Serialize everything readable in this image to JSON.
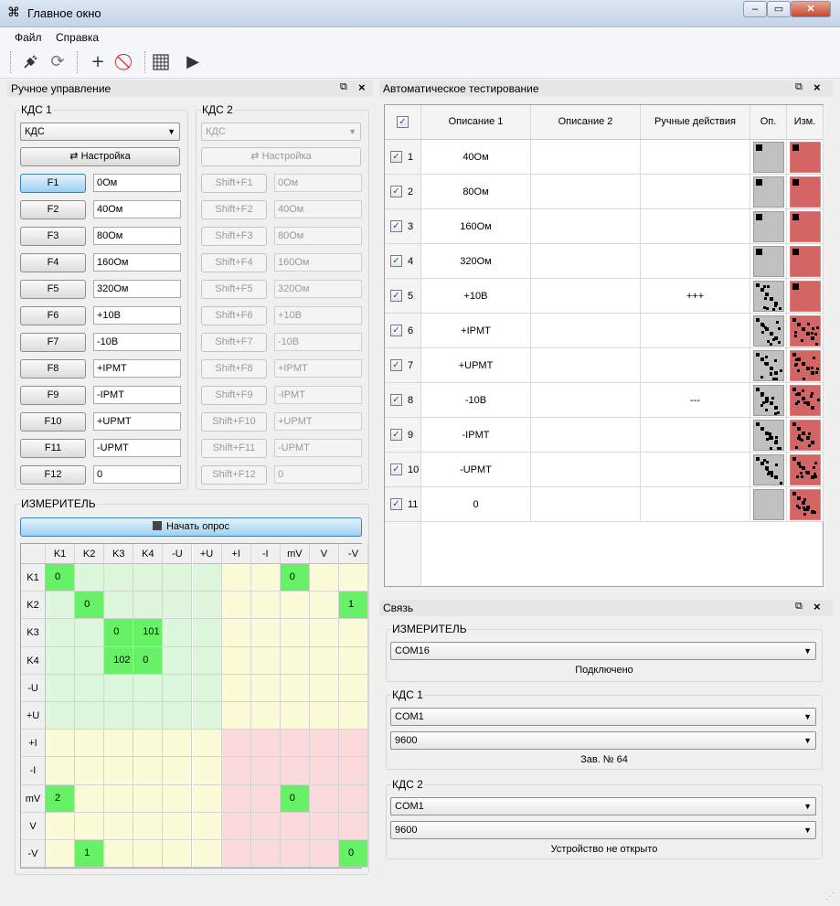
{
  "window": {
    "title": "Главное окно",
    "icon": "app-icon"
  },
  "menu": [
    "Файл",
    "Справка"
  ],
  "toolbar": {
    "icons": [
      "plug-icon",
      "refresh-icon",
      "add-icon",
      "stop-icon",
      "grid-icon",
      "play-icon"
    ]
  },
  "manual": {
    "title": "Ручное управление",
    "kds1": {
      "label": "КДС 1",
      "select": "КДС",
      "settings": "Настройка",
      "rows": [
        {
          "key": "F1",
          "value": "0Ом"
        },
        {
          "key": "F2",
          "value": "40Ом"
        },
        {
          "key": "F3",
          "value": "80Ом"
        },
        {
          "key": "F4",
          "value": "160Ом"
        },
        {
          "key": "F5",
          "value": "320Ом"
        },
        {
          "key": "F6",
          "value": "+10В"
        },
        {
          "key": "F7",
          "value": "-10В"
        },
        {
          "key": "F8",
          "value": "+IPMT"
        },
        {
          "key": "F9",
          "value": "-IPMT"
        },
        {
          "key": "F10",
          "value": "+UPMT"
        },
        {
          "key": "F11",
          "value": "-UPMT"
        },
        {
          "key": "F12",
          "value": "0"
        }
      ]
    },
    "kds2": {
      "label": "КДС 2",
      "select": "КДС",
      "settings": "Настройка",
      "rows": [
        {
          "key": "Shift+F1",
          "value": "0Ом"
        },
        {
          "key": "Shift+F2",
          "value": "40Ом"
        },
        {
          "key": "Shift+F3",
          "value": "80Ом"
        },
        {
          "key": "Shift+F4",
          "value": "160Ом"
        },
        {
          "key": "Shift+F5",
          "value": "320Ом"
        },
        {
          "key": "Shift+F6",
          "value": "+10В"
        },
        {
          "key": "Shift+F7",
          "value": "-10В"
        },
        {
          "key": "Shift+F8",
          "value": "+IPMT"
        },
        {
          "key": "Shift+F9",
          "value": "-IPMT"
        },
        {
          "key": "Shift+F10",
          "value": "+UPMT"
        },
        {
          "key": "Shift+F11",
          "value": "-UPMT"
        },
        {
          "key": "Shift+F12",
          "value": "0"
        }
      ]
    }
  },
  "meter": {
    "label": "ИЗМЕРИТЕЛЬ",
    "start": "Начать опрос",
    "columns": [
      "K1",
      "K2",
      "K3",
      "K4",
      "-U",
      "+U",
      "+I",
      "-I",
      "mV",
      "V",
      "-V"
    ],
    "rows": [
      "K1",
      "K2",
      "K3",
      "K4",
      "-U",
      "+U",
      "+I",
      "-I",
      "mV",
      "V",
      "-V"
    ],
    "cells": [
      [
        "0",
        "",
        "",
        "",
        "",
        "",
        "",
        "",
        "0",
        "",
        ""
      ],
      [
        "",
        "0",
        "",
        "",
        "",
        "",
        "",
        "",
        "",
        "",
        "1"
      ],
      [
        "",
        "",
        "0",
        "101",
        "",
        "",
        "",
        "",
        "",
        "",
        ""
      ],
      [
        "",
        "",
        "102",
        "0",
        "",
        "",
        "",
        "",
        "",
        "",
        ""
      ],
      [
        "",
        "",
        "",
        "",
        "",
        "",
        "",
        "",
        "",
        "",
        ""
      ],
      [
        "",
        "",
        "",
        "",
        "",
        "",
        "",
        "",
        "",
        "",
        ""
      ],
      [
        "",
        "",
        "",
        "",
        "",
        "",
        "",
        "",
        "",
        "",
        ""
      ],
      [
        "",
        "",
        "",
        "",
        "",
        "",
        "",
        "",
        "",
        "",
        ""
      ],
      [
        "2",
        "",
        "",
        "",
        "",
        "",
        "",
        "",
        "0",
        "",
        ""
      ],
      [
        "",
        "",
        "",
        "",
        "",
        "",
        "",
        "",
        "",
        "",
        ""
      ],
      [
        "",
        "1",
        "",
        "",
        "",
        "",
        "",
        "",
        "",
        "",
        "0"
      ]
    ],
    "colors": {
      "green": "#ddf7dd",
      "yellow": "#fbfbd8",
      "red": "#fadadb",
      "value": "#67f167"
    }
  },
  "auto": {
    "title": "Автоматическое тестирование",
    "headers": [
      "Описание 1",
      "Описание 2",
      "Ручные действия",
      "Оп.",
      "Изм."
    ],
    "rows": [
      {
        "n": "1",
        "d1": "40Ом",
        "d2": "",
        "manual": "",
        "op": "single",
        "izm": "single"
      },
      {
        "n": "2",
        "d1": "80Ом",
        "d2": "",
        "manual": "",
        "op": "single",
        "izm": "single"
      },
      {
        "n": "3",
        "d1": "160Ом",
        "d2": "",
        "manual": "",
        "op": "single",
        "izm": "single"
      },
      {
        "n": "4",
        "d1": "320Ом",
        "d2": "",
        "manual": "",
        "op": "single",
        "izm": "single"
      },
      {
        "n": "5",
        "d1": "+10В",
        "d2": "",
        "manual": "+++",
        "op": "pattern",
        "izm": "single"
      },
      {
        "n": "6",
        "d1": "+IPMT",
        "d2": "",
        "manual": "",
        "op": "pattern",
        "izm": "pattern"
      },
      {
        "n": "7",
        "d1": "+UPMT",
        "d2": "",
        "manual": "",
        "op": "pattern",
        "izm": "pattern"
      },
      {
        "n": "8",
        "d1": "-10В",
        "d2": "",
        "manual": "---",
        "op": "pattern",
        "izm": "pattern"
      },
      {
        "n": "9",
        "d1": "-IPMT",
        "d2": "",
        "manual": "",
        "op": "pattern",
        "izm": "pattern"
      },
      {
        "n": "10",
        "d1": "-UPMT",
        "d2": "",
        "manual": "",
        "op": "pattern",
        "izm": "pattern"
      },
      {
        "n": "11",
        "d1": "0",
        "d2": "",
        "manual": "",
        "op": "empty",
        "izm": "pattern"
      }
    ]
  },
  "comm": {
    "title": "Связь",
    "meter": {
      "label": "ИЗМЕРИТЕЛЬ",
      "port": "COM16",
      "status": "Подключено"
    },
    "kds1": {
      "label": "КДС 1",
      "port": "COM1",
      "baud": "9600",
      "status": "Зав. № 64"
    },
    "kds2": {
      "label": "КДС 2",
      "port": "COM1",
      "baud": "9600",
      "status": "Устройство не открыто"
    }
  }
}
